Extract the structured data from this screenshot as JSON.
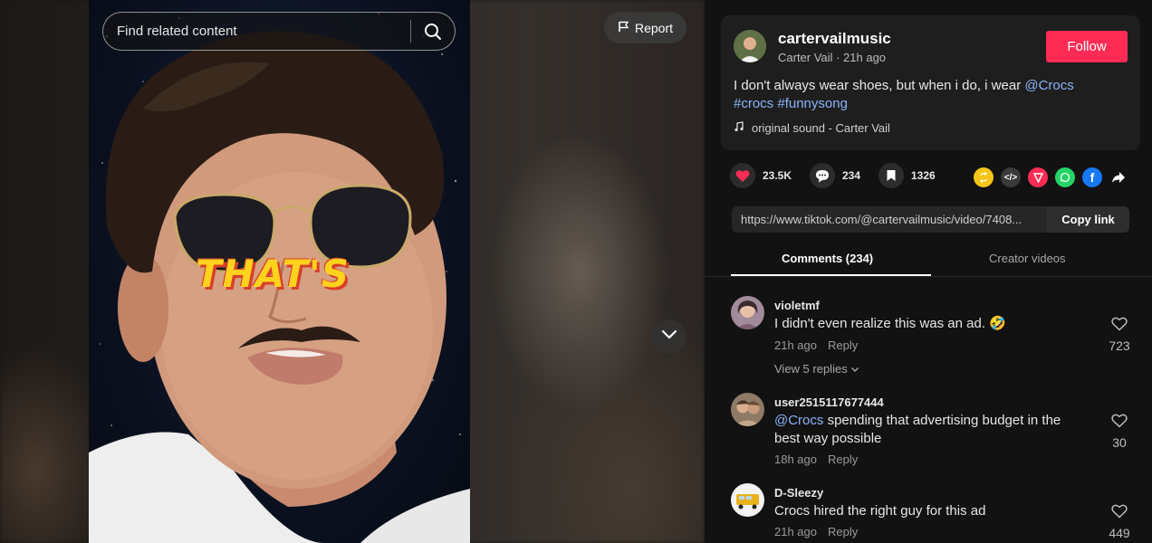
{
  "search": {
    "placeholder": "Find related content"
  },
  "report_label": "Report",
  "video": {
    "overlay_text": "THAT'S"
  },
  "author": {
    "username": "cartervailmusic",
    "display_name": "Carter Vail",
    "time_ago": "21h ago",
    "follow_label": "Follow"
  },
  "caption": {
    "text": "I don't always wear shoes, but when i do, i wear ",
    "mention": "@Crocs",
    "hashtag1": "#crocs",
    "hashtag2": "#funnysong"
  },
  "sound": "original sound - Carter Vail",
  "stats": {
    "likes": "23.5K",
    "comments": "234",
    "saves": "1326"
  },
  "share_icons": [
    "repost-icon",
    "embed-icon",
    "send-icon",
    "whatsapp-icon",
    "facebook-icon",
    "share-arrow-icon"
  ],
  "link": {
    "url": "https://www.tiktok.com/@cartervailmusic/video/7408...",
    "copy_label": "Copy link"
  },
  "tabs": {
    "comments": "Comments (234)",
    "creator": "Creator videos"
  },
  "comments": [
    {
      "user": "violetmf",
      "text": "I didn't even realize this was an ad. 🤣",
      "time": "21h ago",
      "reply": "Reply",
      "likes": "723",
      "view_replies": "View 5 replies"
    },
    {
      "user": "user2515117677444",
      "mention": "@Crocs",
      "text": " spending that advertising budget in the best way possible",
      "time": "18h ago",
      "reply": "Reply",
      "likes": "30"
    },
    {
      "user": "D-Sleezy",
      "text": "Crocs hired the right guy for this ad",
      "time": "21h ago",
      "reply": "Reply",
      "likes": "449"
    }
  ],
  "colors": {
    "follow": "#fe2c55",
    "link_blue": "#8ab4f8",
    "panel_bg": "#121212",
    "card_bg": "#1e1e1e"
  }
}
